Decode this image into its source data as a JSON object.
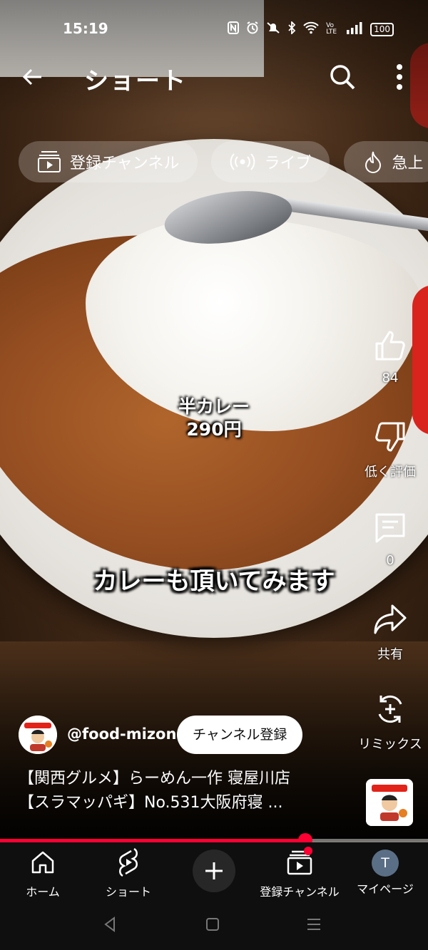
{
  "status_bar": {
    "time": "15:19",
    "battery": "100",
    "network_label": "Vo LTE"
  },
  "header": {
    "title": "ショート"
  },
  "chips": [
    {
      "label": "登録チャンネル",
      "icon": "subscriptions-icon"
    },
    {
      "label": "ライブ",
      "icon": "live-icon"
    },
    {
      "label": "急上",
      "icon": "trending-icon"
    }
  ],
  "video_captions": {
    "price_name": "半カレー",
    "price_value": "290円",
    "subtitle": "カレーも頂いてみます"
  },
  "actions": {
    "like_count": "84",
    "dislike_label": "低く評価",
    "comment_count": "0",
    "share_label": "共有",
    "remix_label": "リミックス"
  },
  "channel": {
    "handle": "@food-mizon",
    "subscribe_label": "チャンネル登録"
  },
  "video": {
    "title_line1": "【関西グルメ】らーめん一作 寝屋川店",
    "title_line2": "【スラマッパギ】No.531大阪府寝 ..."
  },
  "progress": {
    "fraction": 0.713
  },
  "bottom_nav": {
    "home": "ホーム",
    "shorts": "ショート",
    "subscriptions": "登録チャンネル",
    "mypage": "マイページ",
    "mypage_initial": "T"
  },
  "colors": {
    "accent": "#ff0033",
    "nav_bg": "#0f0f0f"
  }
}
